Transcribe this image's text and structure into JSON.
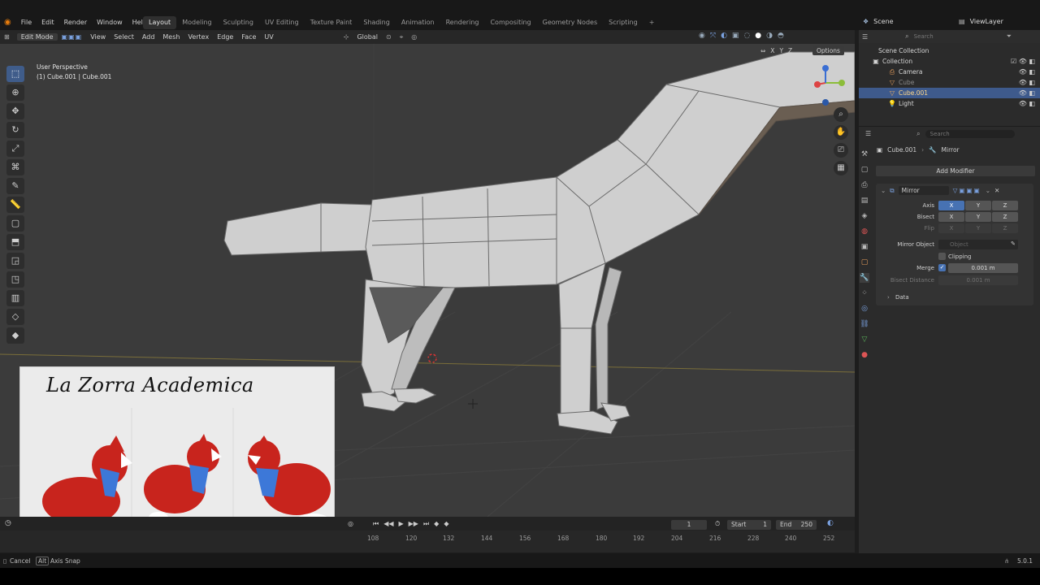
{
  "menu": [
    "File",
    "Edit",
    "Render",
    "Window",
    "Help"
  ],
  "workspaces": [
    "Layout",
    "Modeling",
    "Sculpting",
    "UV Editing",
    "Texture Paint",
    "Shading",
    "Animation",
    "Rendering",
    "Compositing",
    "Geometry Nodes",
    "Scripting"
  ],
  "active_workspace": "Layout",
  "add_workspace": "+",
  "scene": "Scene",
  "view_layer": "ViewLayer",
  "header": {
    "mode": "Edit Mode",
    "items": [
      "View",
      "Select",
      "Add",
      "Mesh",
      "Vertex",
      "Edge",
      "Face",
      "UV"
    ],
    "transform_orientation": "Global"
  },
  "viewport": {
    "perspective": "User Perspective",
    "object_info": "(1) Cube.001 | Cube.001",
    "options": "Options",
    "axes": [
      "X",
      "Y",
      "Z"
    ]
  },
  "outliner": {
    "search_placeholder": "Search",
    "root": "Scene Collection",
    "collection": "Collection",
    "items": [
      {
        "name": "Camera",
        "selected": false
      },
      {
        "name": "Cube",
        "selected": false
      },
      {
        "name": "Cube.001",
        "selected": true
      },
      {
        "name": "Light",
        "selected": false
      }
    ]
  },
  "properties": {
    "search_placeholder": "Search",
    "object": "Cube.001",
    "modifier_tab": "Mirror",
    "add_modifier": "Add Modifier",
    "modifier_name": "Mirror",
    "axis_label": "Axis",
    "bisect_label": "Bisect",
    "flip_label": "Flip",
    "x": "X",
    "y": "Y",
    "z": "Z",
    "mirror_object_label": "Mirror Object",
    "mirror_object_placeholder": "Object",
    "clipping": "Clipping",
    "merge_label": "Merge",
    "merge_value": "0.001 m",
    "bisect_distance_label": "Bisect Distance",
    "bisect_distance_value": "0.001 m",
    "data": "Data"
  },
  "timeline": {
    "current_frame": "1",
    "start_label": "Start",
    "start": "1",
    "end_label": "End",
    "end": "250",
    "ticks": [
      "108",
      "120",
      "132",
      "144",
      "156",
      "168",
      "180",
      "192",
      "204",
      "216",
      "228",
      "240",
      "252"
    ]
  },
  "status": {
    "cancel": "Cancel",
    "alt": "Alt",
    "axis_snap": "Axis Snap",
    "version": "5.0.1"
  },
  "overlay_title": "La Zorra Academica",
  "colors": {
    "accent": "#4772b3",
    "fox_red": "#c8241d",
    "scarf_blue": "#3d78d8"
  }
}
